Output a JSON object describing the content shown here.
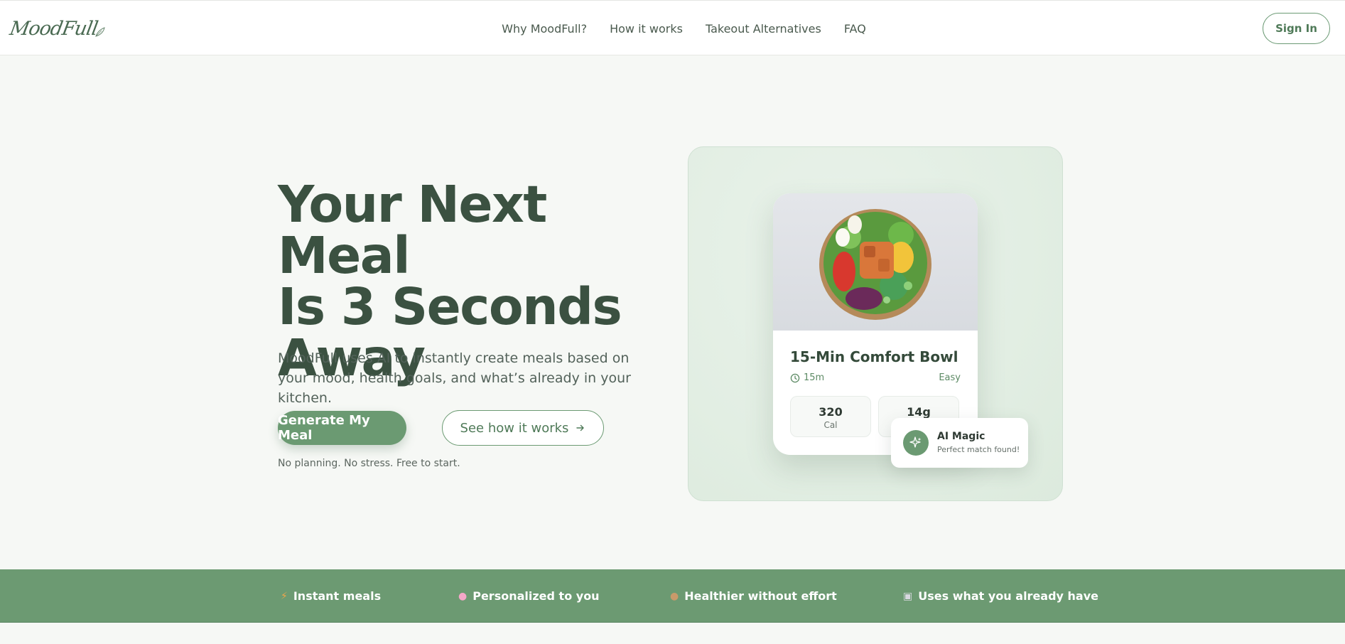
{
  "header": {
    "logo_text": "MoodFull",
    "nav": [
      "Why MoodFull?",
      "How it works",
      "Takeout Alternatives",
      "FAQ"
    ],
    "signin_label": "Sign In"
  },
  "hero": {
    "title_line1": "Your Next Meal",
    "title_line2": "Is 3 Seconds",
    "title_line3": "Away",
    "subtitle": "MoodFull uses AI to instantly create meals based on your mood, health goals, and what’s already in your kitchen.",
    "primary_button": "Generate My Meal",
    "secondary_button": "See how it works",
    "note": "No planning. No stress. Free to start."
  },
  "meal_card": {
    "title": "15-Min Comfort Bowl",
    "time": "15m",
    "difficulty": "Easy",
    "stats": [
      {
        "value": "320",
        "label": "Cal"
      },
      {
        "value": "14g",
        "label": ""
      }
    ]
  },
  "badge": {
    "title": "AI Magic",
    "subtitle": "Perfect match found!"
  },
  "strip": [
    {
      "icon": "lightning-icon",
      "label": "Instant meals"
    },
    {
      "icon": "brain-icon",
      "label": "Personalized to you"
    },
    {
      "icon": "salad-icon",
      "label": "Healthier without effort"
    },
    {
      "icon": "fridge-icon",
      "label": "Uses what you already have"
    }
  ],
  "colors": {
    "accent": "#6b9a72",
    "heading": "#3b5141",
    "background": "#f6f8f5"
  }
}
